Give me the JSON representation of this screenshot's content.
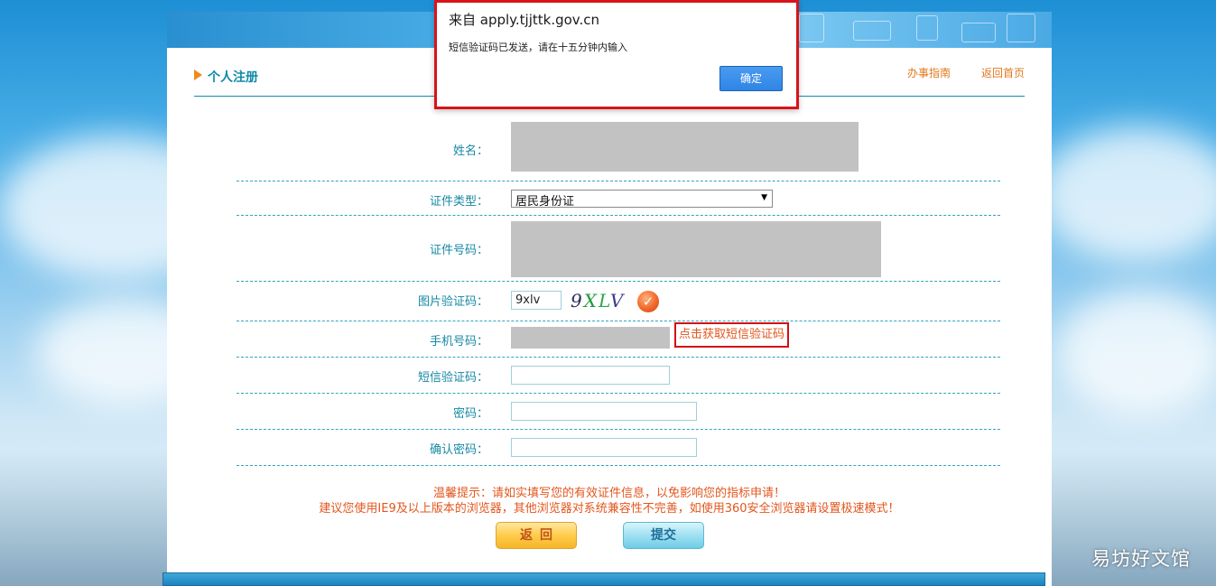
{
  "dialog": {
    "title": "来自 apply.tjjttk.gov.cn",
    "message": "短信验证码已发送，请在十五分钟内输入",
    "ok_label": "确定"
  },
  "header": {
    "title": "个人注册",
    "links": [
      "办事指南",
      "返回首页"
    ]
  },
  "form": {
    "name_label": "姓名：",
    "id_type_label": "证件类型：",
    "id_type_value": "居民身份证",
    "id_number_label": "证件号码：",
    "captcha_label": "图片验证码：",
    "captcha_value": "9xlv",
    "captcha_chars": [
      "9",
      "X",
      "L",
      "V"
    ],
    "phone_label": "手机号码：",
    "sms_button_label": "点击获取短信验证码",
    "sms_code_label": "短信验证码：",
    "password_label": "密码：",
    "confirm_password_label": "确认密码："
  },
  "tips": {
    "line1": "温馨提示：请如实填写您的有效证件信息，以免影响您的指标申请！",
    "line2": "建议您使用IE9及以上版本的浏览器，其他浏览器对系统兼容性不完善，如使用360安全浏览器请设置极速模式！"
  },
  "buttons": {
    "back_label": "返回",
    "submit_label": "提交"
  },
  "watermark": "易坊好文馆",
  "colors": {
    "accent_teal": "#1788a4",
    "warning_orange": "#e2561d",
    "highlight_red": "#d40f14",
    "dialog_button_blue": "#2f85e6"
  },
  "icons": {
    "header": "arrow-icon",
    "captcha_refresh": "check-icon",
    "select": "chevron-down-icon"
  }
}
